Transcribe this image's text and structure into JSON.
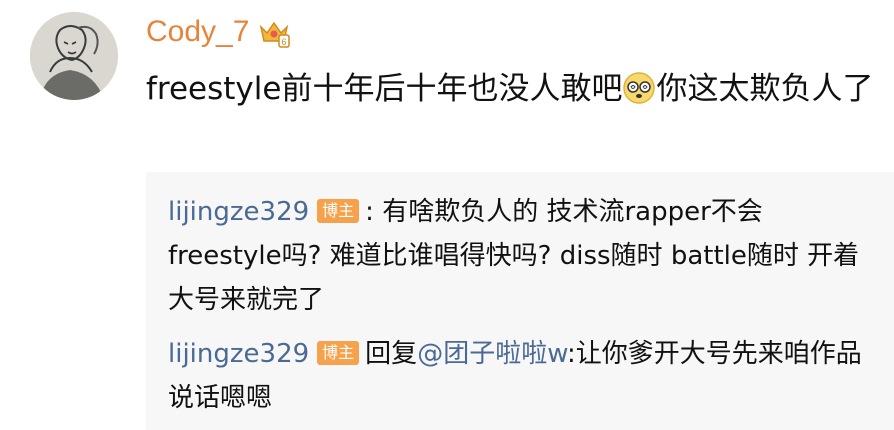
{
  "comment": {
    "username": "Cody_7",
    "text_part1": "freestyle前十年后十年也没人敢吧",
    "text_part2": "你这太欺负人了",
    "avatar_icon": "sketch-avatar-icon",
    "crown_icon": "crown-badge-icon",
    "emoji_icon": "dizzy-face-emoji-icon"
  },
  "replies": [
    {
      "user": "lijingze329",
      "badge": "博主",
      "separator": ":",
      "text": "有啥欺负人的 技术流rapper不会freestyle吗? 难道比谁唱得快吗? diss随时 battle随时 开着大号来就完了"
    },
    {
      "user": "lijingze329",
      "badge": "博主",
      "prefix": "回复",
      "mention": "@团子啦啦w",
      "text": ":让你爹开大号先来咱作品说话嗯嗯"
    }
  ],
  "colors": {
    "username": "#e8843a",
    "reply_user": "#4a6a94",
    "badge_bg": "#f6a24c",
    "reply_bg": "#f7f7f7"
  }
}
